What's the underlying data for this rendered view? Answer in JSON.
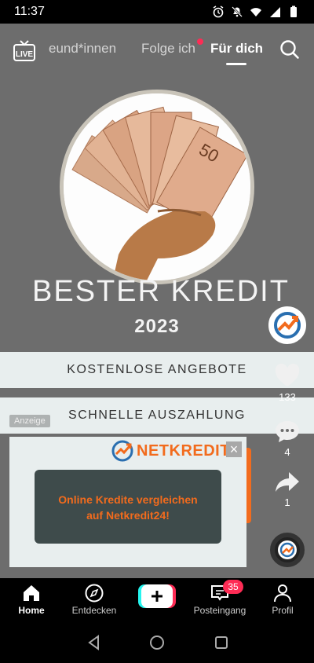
{
  "status_bar": {
    "time": "11:37",
    "icons": [
      "alarm-icon",
      "mute-icon",
      "wifi-icon",
      "signal-icon",
      "battery-icon"
    ]
  },
  "top_tabs": {
    "live_label": "LIVE",
    "tabs": [
      {
        "label": "Freund*innen",
        "visible_label": "eund*innen",
        "active": false
      },
      {
        "label": "Folge ich",
        "active": false,
        "has_dot": true
      },
      {
        "label": "Für dich",
        "active": true
      }
    ]
  },
  "ad": {
    "title": "BESTER KREDIT",
    "year": "2023",
    "banner_1": "KOSTENLOSE ANGEBOTE",
    "banner_2": "SCHNELLE AUSZAHLUNG",
    "sponsored_label": "Anzeige",
    "card": {
      "brand": "NETKREDIT",
      "close_glyph": "×",
      "text_line_1": "Online Kredite vergleichen",
      "text_line_2": "auf Netkredit24!"
    }
  },
  "side_actions": {
    "likes": "133",
    "comments": "4",
    "shares": "1"
  },
  "bottom_nav": {
    "items": [
      {
        "label": "Home",
        "active": true
      },
      {
        "label": "Entdecken",
        "active": false
      },
      {
        "label": "Posteingang",
        "active": false,
        "badge": "35"
      },
      {
        "label": "Profil",
        "active": false
      }
    ]
  },
  "colors": {
    "accent": "#fe2c55",
    "brand_orange": "#f26b1d",
    "feed_bg": "#6d6d6d"
  }
}
